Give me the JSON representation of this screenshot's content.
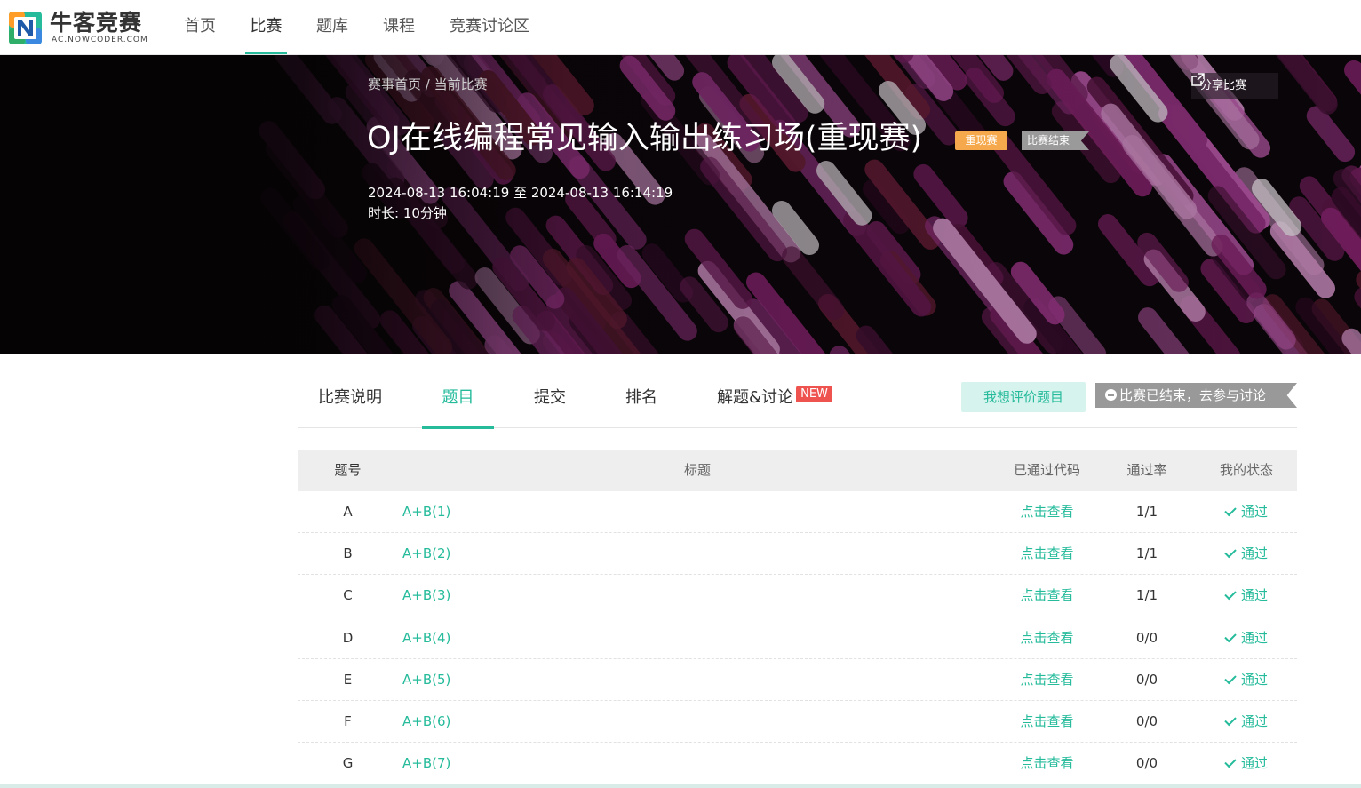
{
  "logo": {
    "title": "牛客竞赛",
    "subtitle": "AC.NOWCODER.COM"
  },
  "nav": [
    {
      "label": "首页",
      "active": false
    },
    {
      "label": "比赛",
      "active": true
    },
    {
      "label": "题库",
      "active": false
    },
    {
      "label": "课程",
      "active": false
    },
    {
      "label": "竞赛讨论区",
      "active": false
    }
  ],
  "breadcrumb": {
    "home": "赛事首页",
    "sep": " / ",
    "current": "当前比赛"
  },
  "contest": {
    "title": "OJ在线编程常见输入输出练习场(重现赛)",
    "tag_replay": "重现赛",
    "tag_status": "比赛结束",
    "time_range": "2024-08-13 16:04:19 至 2024-08-13 16:14:19",
    "duration": "时长: 10分钟",
    "share_label": "分享比赛"
  },
  "tabs": [
    {
      "label": "比赛说明",
      "active": false
    },
    {
      "label": "题目",
      "active": true
    },
    {
      "label": "提交",
      "active": false
    },
    {
      "label": "排名",
      "active": false
    },
    {
      "label": "解题&讨论",
      "active": false
    }
  ],
  "new_badge": "NEW",
  "rate_button": "我想评价题目",
  "discuss_button": "比赛已结束，去参与讨论",
  "table": {
    "headers": {
      "id": "题号",
      "title": "标题",
      "code": "已通过代码",
      "rate": "通过率",
      "status": "我的状态"
    },
    "rows": [
      {
        "id": "A",
        "title": "A+B(1)",
        "code": "点击查看",
        "rate": "1/1",
        "status": "通过"
      },
      {
        "id": "B",
        "title": "A+B(2)",
        "code": "点击查看",
        "rate": "1/1",
        "status": "通过"
      },
      {
        "id": "C",
        "title": "A+B(3)",
        "code": "点击查看",
        "rate": "1/1",
        "status": "通过"
      },
      {
        "id": "D",
        "title": "A+B(4)",
        "code": "点击查看",
        "rate": "0/0",
        "status": "通过"
      },
      {
        "id": "E",
        "title": "A+B(5)",
        "code": "点击查看",
        "rate": "0/0",
        "status": "通过"
      },
      {
        "id": "F",
        "title": "A+B(6)",
        "code": "点击查看",
        "rate": "0/0",
        "status": "通过"
      },
      {
        "id": "G",
        "title": "A+B(7)",
        "code": "点击查看",
        "rate": "0/0",
        "status": "通过"
      }
    ]
  },
  "colors": {
    "accent": "#25bb9b",
    "replay_tag": "#f5a94c",
    "ended_tag": "#9a9a9a",
    "new_badge": "#ef5350"
  }
}
